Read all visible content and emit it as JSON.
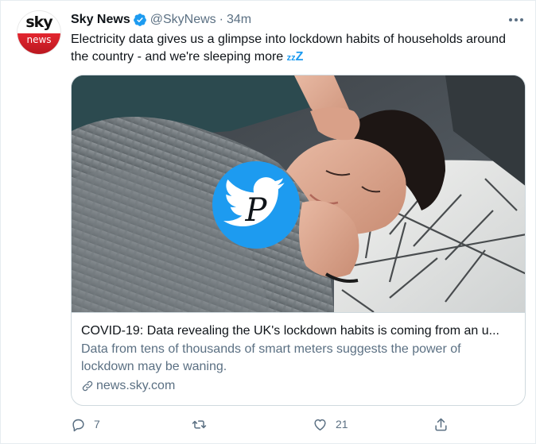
{
  "account": {
    "name": "Sky News",
    "handle": "@SkyNews",
    "separator": "·",
    "time": "34m",
    "avatar_top": "sky",
    "avatar_bottom": "news"
  },
  "tweet": {
    "text": "Electricity data gives us a glimpse into lockdown habits of households around the country - and we're sleeping more",
    "emoji_small": "zz",
    "emoji_big": "Z"
  },
  "card": {
    "title": "COVID-19: Data revealing the UK's lockdown habits is coming from an u...",
    "description": "Data from tens of thousands of smart meters suggests the power of lockdown may be waning.",
    "domain": "news.sky.com",
    "image_icon": "twitter-bird-watermark-icon"
  },
  "actions": {
    "replies": "7",
    "retweets": "",
    "likes": "21"
  },
  "colors": {
    "accent": "#1d9bf0",
    "secondary_text": "#5b7083",
    "sky_red": "#e3262f"
  }
}
